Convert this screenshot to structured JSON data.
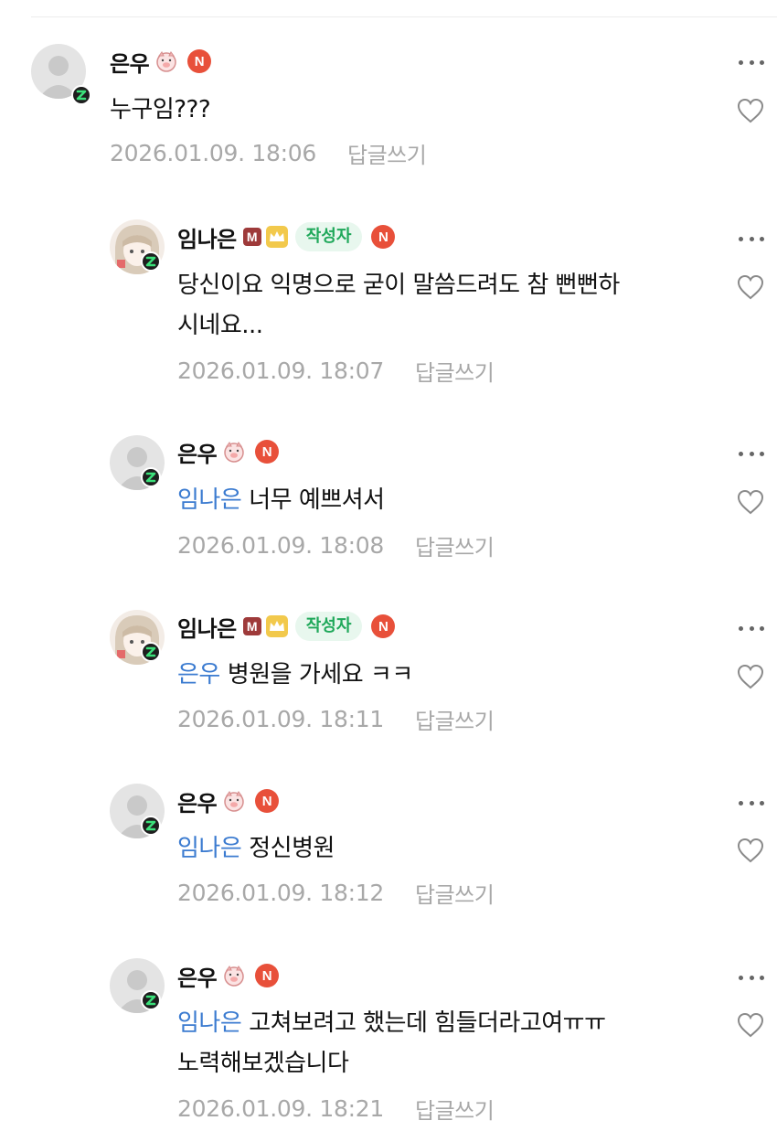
{
  "colors": {
    "mention": "#3b7bd0",
    "meta": "#a8a8a8",
    "author_tag_bg": "#e8f7ee",
    "author_tag_text": "#1fa85a",
    "n_badge": "#e8503a",
    "m_badge": "#9e3a3a",
    "crown_badge": "#f2c94c"
  },
  "comments": [
    {
      "nickname": "은우",
      "icons": [
        "pig-face-icon",
        "n-badge-icon"
      ],
      "n_label": "N",
      "mention": "",
      "text_lines": [
        "누구임???"
      ],
      "date": "2026.01.09. 18:06",
      "reply_label": "답글쓰기"
    },
    {
      "nickname": "임나은",
      "icons": [
        "manager-m-icon",
        "crown-icon",
        "author-tag",
        "n-badge-icon"
      ],
      "m_label": "M",
      "author_tag": "작성자",
      "n_label": "N",
      "mention": "",
      "text_lines": [
        "당신이요 익명으로 굳이 말씀드려도 참 뻔뻔하",
        "시네요..."
      ],
      "date": "2026.01.09. 18:07",
      "reply_label": "답글쓰기"
    },
    {
      "nickname": "은우",
      "icons": [
        "pig-face-icon",
        "n-badge-icon"
      ],
      "n_label": "N",
      "mention": "임나은",
      "text_lines": [
        "너무 예쁘셔서"
      ],
      "date": "2026.01.09. 18:08",
      "reply_label": "답글쓰기"
    },
    {
      "nickname": "임나은",
      "icons": [
        "manager-m-icon",
        "crown-icon",
        "author-tag",
        "n-badge-icon"
      ],
      "m_label": "M",
      "author_tag": "작성자",
      "n_label": "N",
      "mention": "은우",
      "text_lines": [
        "병원을 가세요 ㅋㅋ"
      ],
      "date": "2026.01.09. 18:11",
      "reply_label": "답글쓰기"
    },
    {
      "nickname": "은우",
      "icons": [
        "pig-face-icon",
        "n-badge-icon"
      ],
      "n_label": "N",
      "mention": "임나은",
      "text_lines": [
        "정신병원"
      ],
      "date": "2026.01.09. 18:12",
      "reply_label": "답글쓰기"
    },
    {
      "nickname": "은우",
      "icons": [
        "pig-face-icon",
        "n-badge-icon"
      ],
      "n_label": "N",
      "mention": "임나은",
      "text_lines": [
        "고쳐보려고 했는데 힘들더라고여ㅠㅠ",
        "노력해보겠습니다"
      ],
      "date": "2026.01.09. 18:21",
      "reply_label": "답글쓰기"
    }
  ]
}
